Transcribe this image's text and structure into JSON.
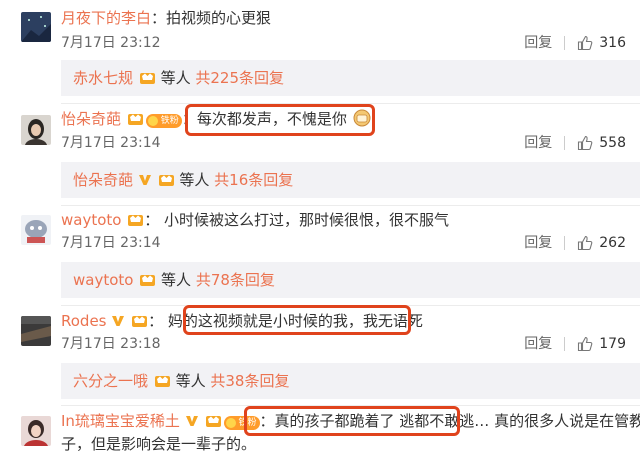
{
  "comments": [
    {
      "user": "月夜下的李白",
      "colon": "：",
      "text": "拍视频的心更狠",
      "time": "7月17日 23:12",
      "reply": "回复",
      "likes": "316",
      "sub": {
        "user": "赤水七规",
        "deng": "等人",
        "more": "共225条回复"
      }
    },
    {
      "user": "怡朵奇葩",
      "colon": "：",
      "text": "每次都发声，不愧是你",
      "time": "7月17日 23:14",
      "reply": "回复",
      "likes": "558",
      "fan_badge": "铁粉",
      "sub": {
        "user": "怡朵奇葩",
        "deng": "等人",
        "more": "共16条回复"
      }
    },
    {
      "user": "waytoto",
      "colon": "：",
      "text": "小时候被这么打过，那时候很恨，很不服气",
      "time": "7月17日 23:14",
      "reply": "回复",
      "likes": "262",
      "sub": {
        "user": "waytoto",
        "deng": "等人",
        "more": "共78条回复"
      }
    },
    {
      "user": "Rodes",
      "colon": "：",
      "text_prefix": "妈的",
      "text": "这视频就是小时候的我，我无语死",
      "time": "7月17日 23:18",
      "reply": "回复",
      "likes": "179",
      "sub": {
        "user": "六分之一哦",
        "deng": "等人",
        "more": "共38条回复"
      }
    },
    {
      "user": "In琉璃宝宝爱稀土",
      "colon": "：",
      "text_highlight": "真的孩子都跪着了 逃都不敢逃…",
      "text_rest": "真的很多人说是在管教孩",
      "text_line2": "子，但是影响会是一辈子的。",
      "fan_badge": "铁粉"
    }
  ],
  "colors": {
    "username": "#eb7350",
    "highlight": "#e0431c",
    "sub_bg": "#f2f2f5"
  }
}
